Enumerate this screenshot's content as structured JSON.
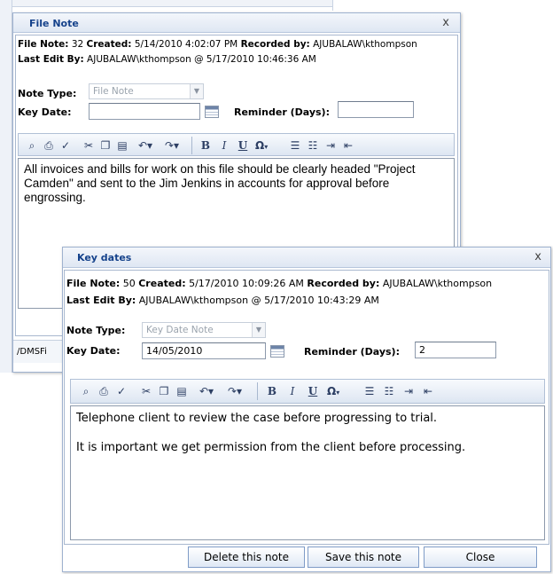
{
  "background_dialog": {
    "title": "File Note",
    "close_glyph": "x",
    "meta_line1_label1": "File Note:",
    "meta_line1_value1": " 32 ",
    "meta_line1_label2": "Created:",
    "meta_line1_value2": " 5/14/2010 4:02:07 PM ",
    "meta_line1_label3": "Recorded by:",
    "meta_line1_value3": " AJUBALAW\\kthompson",
    "meta_line2_label": "Last Edit By:",
    "meta_line2_value": " AJUBALAW\\kthompson @ 5/17/2010 10:46:36 AM",
    "note_type_label": "Note Type:",
    "note_type_value": "File Note",
    "key_date_label": "Key Date:",
    "key_date_value": "",
    "reminder_label": "Reminder (Days):",
    "reminder_value": "",
    "note_text": "All invoices and bills for work on this file should be clearly headed \"Project Camden\" and sent to the Jim Jenkins in accounts for approval before engrossing.",
    "status_text": "/DMSFi"
  },
  "foreground_dialog": {
    "title": "Key dates",
    "close_glyph": "x",
    "meta_line1_label1": "File Note:",
    "meta_line1_value1": " 50 ",
    "meta_line1_label2": "Created:",
    "meta_line1_value2": " 5/17/2010 10:09:26 AM ",
    "meta_line1_label3": "Recorded by:",
    "meta_line1_value3": " AJUBALAW\\kthompson",
    "meta_line2_label": "Last Edit By:",
    "meta_line2_value": " AJUBALAW\\kthompson @ 5/17/2010 10:43:29 AM",
    "note_type_label": "Note Type:",
    "note_type_value": "Key Date Note",
    "key_date_label": "Key Date:",
    "key_date_value": "14/05/2010",
    "reminder_label": "Reminder (Days):",
    "reminder_value": "2",
    "note_line1": "Telephone client to review the case before progressing to trial.",
    "note_line2": "It is important we get permission from the client before processing.",
    "buttons": {
      "delete": "Delete this note",
      "save": "Save this note",
      "close": "Close"
    }
  },
  "toolbar_icons": {
    "find": "binoculars-icon",
    "print": "printer-icon",
    "spell": "spellcheck-icon",
    "cut": "scissors-icon",
    "copy": "copy-icon",
    "paste": "paste-icon",
    "undo": "undo-icon",
    "redo": "redo-icon",
    "bold": "B",
    "italic": "I",
    "underline": "U",
    "symbol": "Ω",
    "ordered_list": "ordered-list-icon",
    "bullet_list": "bullet-list-icon",
    "indent": "indent-icon",
    "outdent": "outdent-icon"
  },
  "colors": {
    "title_text": "#15428b",
    "border": "#9fb2cf"
  }
}
